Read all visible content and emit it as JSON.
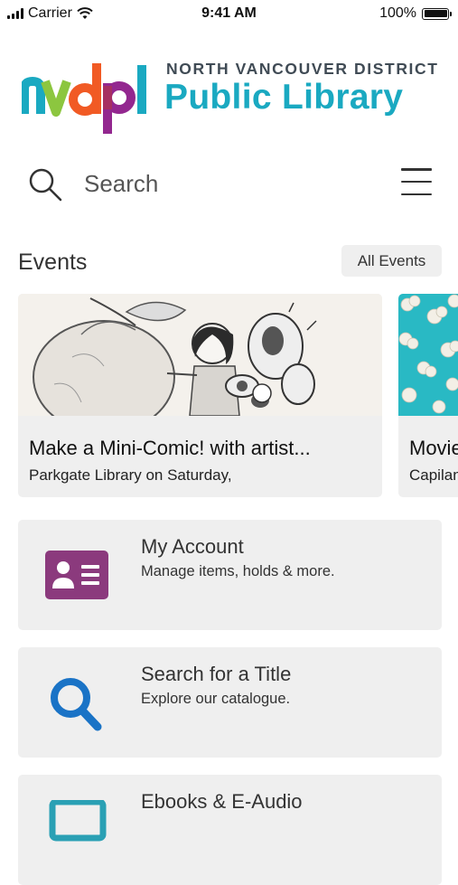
{
  "status_bar": {
    "carrier": "Carrier",
    "time": "9:41 AM",
    "battery": "100%",
    "battery_level": 1.0
  },
  "logo": {
    "mark_text": "nvdpl",
    "top_line": "NORTH VANCOUVER DISTRICT",
    "bottom_line": "Public Library",
    "colors": {
      "n": "#1aa9c1",
      "v": "#8cc63f",
      "d": "#f15a24",
      "p": "#93278f",
      "l": "#1aa9c1"
    }
  },
  "search": {
    "placeholder": "Search"
  },
  "events": {
    "title": "Events",
    "all_events_label": "All Events",
    "cards": [
      {
        "title": "Make a Mini-Comic! with artist...",
        "subtitle": "Parkgate Library on Saturday,"
      },
      {
        "title": "Movie",
        "subtitle": "Capilano"
      }
    ]
  },
  "tiles": [
    {
      "title": "My Account",
      "subtitle": "Manage items, holds & more.",
      "icon": "account-card-icon",
      "color": "#8b3a7d"
    },
    {
      "title": "Search for a Title",
      "subtitle": "Explore our catalogue.",
      "icon": "magnifier-icon",
      "color": "#1a73c6"
    },
    {
      "title": "Ebooks & E-Audio",
      "subtitle": "",
      "icon": "device-icon",
      "color": "#2aa0b4"
    }
  ]
}
